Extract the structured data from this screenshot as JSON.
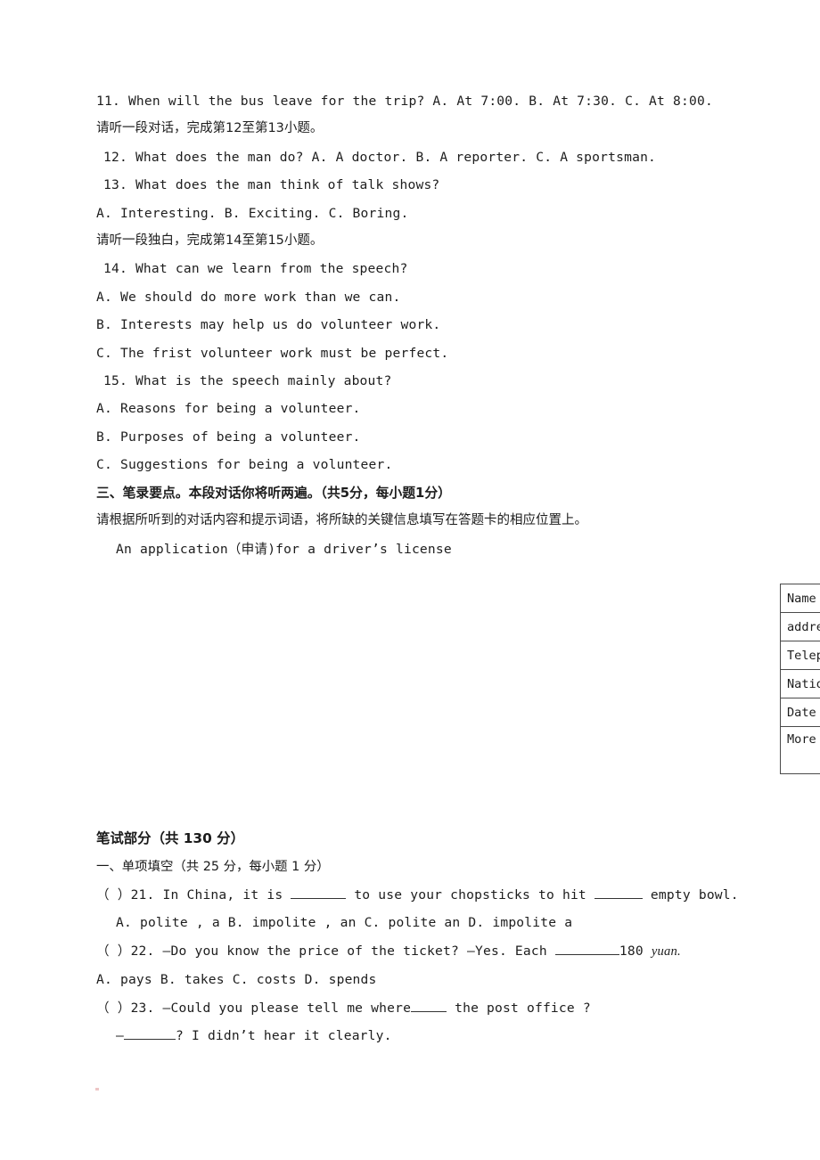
{
  "document": {
    "listening_section": {
      "items": [
        {
          "id": "q11",
          "text": "11. When will the bus leave for the trip?   A. At 7:00. B. At 7:30. C. At 8:00.",
          "style": "en"
        },
        {
          "id": "inst12",
          "text": "请听一段对话，完成第12至第13小题。",
          "style": "cn"
        },
        {
          "id": "q12",
          "text": "12. What does the man do?   A. A doctor.    B. A reporter.    C. A sportsman.",
          "style": "en",
          "indent": 1
        },
        {
          "id": "q13",
          "text": "13. What does the man think of talk shows?",
          "style": "en",
          "indent": 1
        },
        {
          "id": "q13opts",
          "text": "A. Interesting.  B. Exciting.    C. Boring.",
          "style": "en"
        },
        {
          "id": "inst14",
          "text": "请听一段独白，完成第14至第15小题。",
          "style": "cn"
        },
        {
          "id": "q14",
          "text": "14. What can we learn from the speech?",
          "style": "en",
          "indent": 1
        },
        {
          "id": "q14a",
          "text": "A. We should do more work than we can.",
          "style": "en"
        },
        {
          "id": "q14b",
          "text": "B. Interests may help us do volunteer work.",
          "style": "en"
        },
        {
          "id": "q14c",
          "text": "C. The frist volunteer work must be perfect.",
          "style": "en"
        },
        {
          "id": "q15",
          "text": "15. What is the speech mainly about?",
          "style": "en",
          "indent": 1
        },
        {
          "id": "q15a",
          "text": "A. Reasons for being a volunteer.",
          "style": "en"
        },
        {
          "id": "q15b",
          "text": "B. Purposes of being a volunteer.",
          "style": "en"
        },
        {
          "id": "q15c",
          "text": "C. Suggestions for being a volunteer.",
          "style": "en"
        }
      ]
    },
    "notes_section": {
      "heading": "三、笔录要点。本段对话你将听两遍。（共5分，每小题1分）",
      "instruction": "请根据所听到的对话内容和提示词语，将所缺的关键信息填写在答题卡的相应位置上。",
      "form_title": "An application（申请)for a driver’s license",
      "form_rows": [
        {
          "label": "Name"
        },
        {
          "label": "address"
        },
        {
          "label": "Telephone"
        },
        {
          "label": "Nationality"
        },
        {
          "label": "Date"
        },
        {
          "label": "More"
        }
      ]
    },
    "written_section": {
      "heading": "笔试部分（共 130 分）",
      "part_one_heading": "一、单项填空（共 25 分，每小题 1 分）",
      "q21": {
        "prefix": "（ ）21. In China, it is",
        "mid": "to use your chopsticks to hit",
        "suffix": "empty bowl.",
        "options": "A. polite , a        B. impolite , an    C. polite an            D. impolite a"
      },
      "q22": {
        "prefix": "（ ）22.  —Do you know the price of the ticket?    —Yes. Each",
        "amount": "180",
        "unit": "yuan.",
        "options": "A.  pays                   B.  takes                  C.  costs              D.  spends"
      },
      "q23": {
        "line1_prefix": "（ ）23. —Could you please tell me where",
        "line1_suffix": "the post office ?",
        "line2_prefix": "—",
        "line2_suffix": "? I didn’t hear it clearly."
      }
    }
  }
}
